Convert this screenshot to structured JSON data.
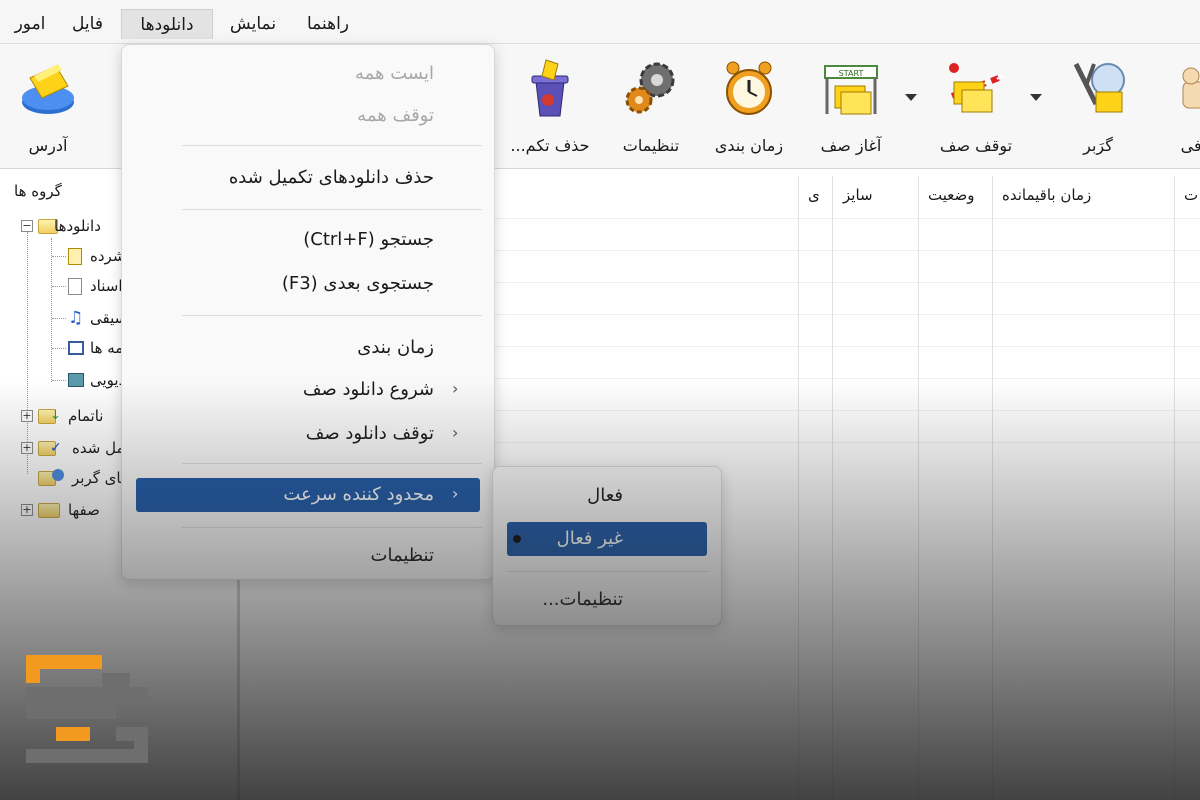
{
  "menubar": {
    "items": [
      "امور",
      "فایل",
      "دانلودها",
      "نمایش",
      "راهنما"
    ],
    "active": "دانلودها"
  },
  "toolbar": {
    "buttons": [
      {
        "label": "آدرس",
        "icon": "add-url-icon"
      },
      {
        "label": "...حذف تکم",
        "icon": "delete-completed-icon"
      },
      {
        "label": "تنظیمات",
        "icon": "options-gears-icon"
      },
      {
        "label": "زمان بندی",
        "icon": "scheduler-clock-icon"
      },
      {
        "label": "آغاز صف",
        "icon": "start-queue-icon"
      },
      {
        "label": "توقف صف",
        "icon": "stop-queue-icon"
      },
      {
        "label": "گرَبر",
        "icon": "grabber-icon"
      },
      {
        "label": "رفی",
        "icon": "tell-friend-icon"
      }
    ]
  },
  "sidebar": {
    "title": "گروه ها",
    "tree": {
      "root": "دانلودها",
      "children": [
        "فشرده",
        "اسناد",
        "موسیقی",
        "برنامه ها",
        "ویدیویی"
      ],
      "groups": [
        "ناتمام",
        "کامل شده",
        "پروژه های گربر",
        "صفها"
      ]
    }
  },
  "list": {
    "columns": [
      "زمان باقیمانده",
      "وضعیت",
      "سایز",
      "ی"
    ],
    "edge_column": "ت"
  },
  "downloads_menu": {
    "items": [
      {
        "label": "ایست همه",
        "disabled": true
      },
      {
        "label": "توقف همه",
        "disabled": true
      },
      {
        "label": "حذف دانلودهای تکمیل شده",
        "disabled": false
      },
      {
        "label": "جستجو (Ctrl+F)",
        "disabled": false
      },
      {
        "label": "جستجوی بعدی (F3)",
        "disabled": false
      },
      {
        "label": "زمان بندی",
        "disabled": false
      },
      {
        "label": "شروع دانلود صف",
        "disabled": false,
        "submenu": true
      },
      {
        "label": "توقف دانلود صف",
        "disabled": false,
        "submenu": true
      },
      {
        "label": "محدود کننده سرعت",
        "disabled": false,
        "submenu": true,
        "highlighted": true
      },
      {
        "label": "تنظیمات",
        "disabled": false
      }
    ],
    "submenu_arrow": "›"
  },
  "speed_limiter_submenu": {
    "items": [
      {
        "label": "فعال",
        "selected": false
      },
      {
        "label": "غیر فعال",
        "selected": true,
        "highlighted": true
      },
      {
        "label": "تنظیمات...",
        "selected": false
      }
    ]
  },
  "colors": {
    "highlight": "#1f5aa8",
    "logo_orange": "#f29a1f",
    "logo_gray": "#6e6e6e"
  }
}
